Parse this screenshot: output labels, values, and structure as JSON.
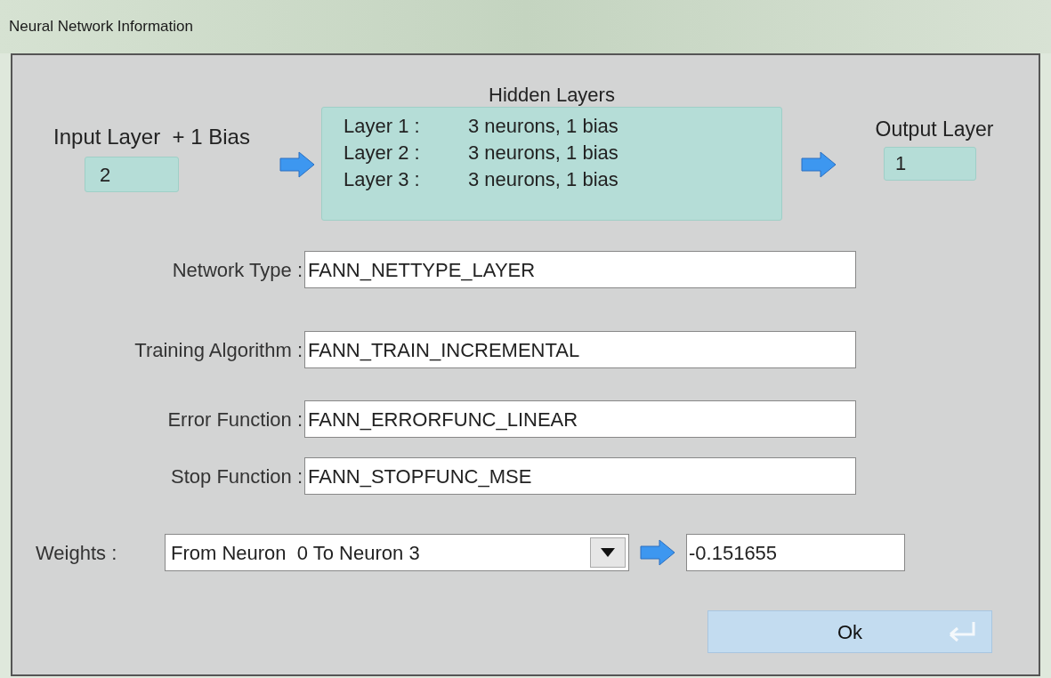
{
  "window": {
    "title": "Neural Network Information"
  },
  "input_layer": {
    "label": "Input Layer  + 1 Bias",
    "value": "2"
  },
  "hidden_layers": {
    "title": "Hidden Layers",
    "layers": [
      {
        "name": "Layer 1 :",
        "description": "3 neurons, 1 bias"
      },
      {
        "name": "Layer 2 :",
        "description": "3 neurons, 1 bias"
      },
      {
        "name": "Layer 3 :",
        "description": "3 neurons, 1 bias"
      }
    ]
  },
  "output_layer": {
    "label": "Output Layer",
    "value": "1"
  },
  "fields": [
    {
      "label": "Network Type :",
      "value": "FANN_NETTYPE_LAYER"
    },
    {
      "label": "Training Algorithm :",
      "value": "FANN_TRAIN_INCREMENTAL"
    },
    {
      "label": "Error Function :",
      "value": "FANN_ERRORFUNC_LINEAR"
    },
    {
      "label": "Stop Function :",
      "value": "FANN_STOPFUNC_MSE"
    }
  ],
  "weights": {
    "label": "Weights :",
    "selection": "From Neuron  0 To Neuron 3",
    "value": "-0.151655"
  },
  "buttons": [
    {
      "label": "Ok"
    }
  ]
}
